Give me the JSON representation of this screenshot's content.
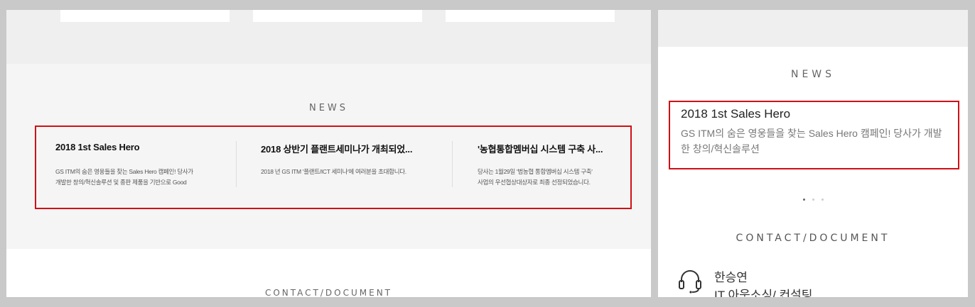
{
  "left_view": {
    "news_heading": "NEWS",
    "news_items": [
      {
        "title": "2018 1st Sales Hero",
        "desc_line1": "GS ITM의 숨은 영웅들을 찾는 Sales Hero 캠페인! 당사가",
        "desc_line2": "개발한 창의/혁신솔루션 및 종판 제품을 기반으로 Good"
      },
      {
        "title": "2018 상반기 플랜트세미나가 개최되었...",
        "desc_line1": "2018 년 GS ITM '플랜트/ICT 세미나'에 여러분을 초대합니다.",
        "desc_line2": ""
      },
      {
        "title": "'농협통합멤버십 시스템 구축 사...",
        "desc_line1": "당사는 1월29일 '범농협 통합멤버십 시스템 구축'",
        "desc_line2": "사업의 우선협상대상자로 최종 선정되었습니다."
      }
    ],
    "contact_heading": "CONTACT/DOCUMENT"
  },
  "right_view": {
    "news_heading": "NEWS",
    "news_item": {
      "title": "2018 1st Sales Hero",
      "desc": "GS ITM의 숨은 영웅들을 찾는 Sales Hero 캠페인! 당사가 개발한 창의/혁신솔루션"
    },
    "carousel": {
      "count": 3,
      "active_index": 0
    },
    "contact_heading": "CONTACT/DOCUMENT",
    "contact": {
      "icon": "headset-icon",
      "name": "한승연",
      "dept": "IT 아웃소싱/ 컨설팅"
    }
  },
  "colors": {
    "highlight": "#d10f16",
    "band": "#f5f5f5",
    "gray": "#efefef"
  }
}
